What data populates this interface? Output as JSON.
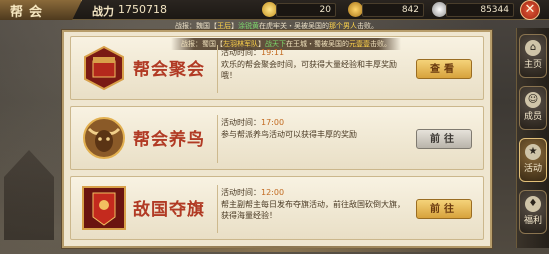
{
  "header": {
    "guild_tab": "帮会",
    "power_label": "战力",
    "power_value": "1750718",
    "resources": [
      {
        "name": "gold-ingot",
        "value": "20",
        "color": "#e8c24a"
      },
      {
        "name": "coin",
        "value": "842",
        "color": "#d9b24a"
      },
      {
        "name": "silver",
        "value": "85344",
        "color": "#c9c9c9"
      }
    ],
    "close_label": "✕"
  },
  "notice_top": {
    "prefix": "战报：魏国【",
    "role": "王后",
    "mid1": "】",
    "name": "涂锐黄",
    "mid2": "在虎牢关・吴被吴国的",
    "target": "那个男人",
    "suffix": "击败。"
  },
  "notice_banner": {
    "prefix": "战报：蜀国【",
    "unit": "左羽林军队",
    "mid1": "】",
    "name": "战天下",
    "mid2": "在王城・蜀被吴国的",
    "target": "元壹壹",
    "suffix": "击败。"
  },
  "events": [
    {
      "title": "帮会聚会",
      "time_label": "活动时间：",
      "time": "19:11",
      "desc": "欢乐的帮会聚会时间，可获得大量经验和丰厚奖励哦！",
      "button": "查看",
      "button_style": "gold",
      "icon": "feast-chest-icon"
    },
    {
      "title": "帮会养鸟",
      "time_label": "活动时间：",
      "time": "17:00",
      "desc": "参与帮派养鸟活动可以获得丰厚的奖励",
      "button": "前往",
      "button_style": "gray",
      "icon": "bull-head-icon"
    },
    {
      "title": "敌国夺旗",
      "time_label": "活动时间：",
      "time": "12:00",
      "desc": "帮主副帮主每日发布夺旗活动，前往敌国砍倒大旗，获得海量经验！",
      "button": "前往",
      "button_style": "gold",
      "icon": "war-flag-icon"
    }
  ],
  "right_nav": [
    {
      "label": "主页",
      "icon": "home-icon",
      "active": false
    },
    {
      "label": "成员",
      "icon": "members-icon",
      "active": false
    },
    {
      "label": "活动",
      "icon": "activity-icon",
      "active": true
    },
    {
      "label": "福利",
      "icon": "welfare-icon",
      "active": false
    }
  ]
}
